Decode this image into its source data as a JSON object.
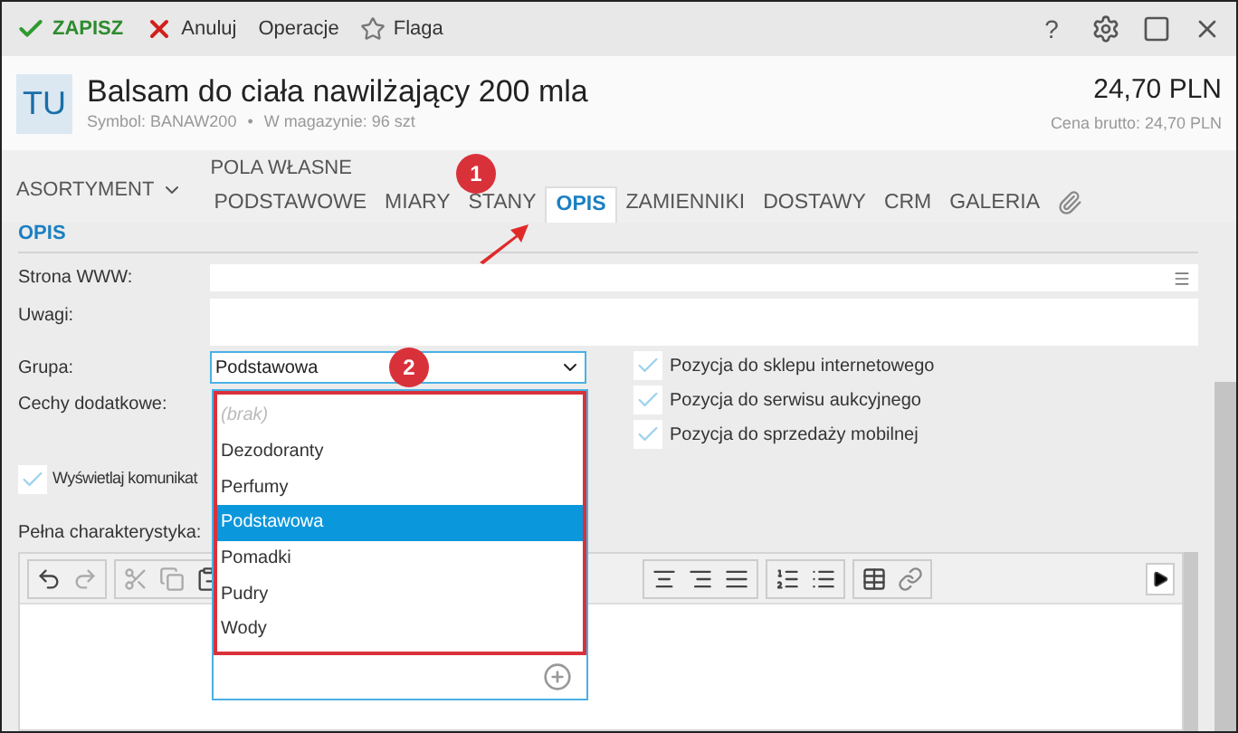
{
  "toolbar": [
    {
      "kind": "save",
      "label": "ZAPISZ"
    },
    {
      "kind": "cancel",
      "label": "Anuluj"
    },
    {
      "kind": "plain",
      "label": "Operacje"
    },
    {
      "kind": "flag",
      "label": "Flaga"
    }
  ],
  "window_controls": {
    "help": "?"
  },
  "header": {
    "avatar": "TU",
    "title": "Balsam do ciała nawilżający 200 mla",
    "symbol": "Symbol: BANAW200",
    "separator": "•",
    "stock": "W magazynie: 96 szt",
    "price": "24,70 PLN",
    "gross": "Cena brutto: 24,70 PLN"
  },
  "menu": {
    "label": "ASORTYMENT"
  },
  "tab_group_label": "POLA WŁASNE",
  "tabs": [
    {
      "label": "PODSTAWOWE",
      "selected": false
    },
    {
      "label": "MIARY",
      "selected": false
    },
    {
      "label": "STANY",
      "selected": false
    },
    {
      "label": "OPIS",
      "selected": true
    },
    {
      "label": "ZAMIENNIKI",
      "selected": false
    },
    {
      "label": "DOSTAWY",
      "selected": false
    },
    {
      "label": "CRM",
      "selected": false
    },
    {
      "label": "GALERIA",
      "selected": false
    }
  ],
  "section_title": "OPIS",
  "form": {
    "www_label": "Strona WWW:",
    "notes_label": "Uwagi:",
    "group_label": "Grupa:",
    "group_value": "Podstawowa",
    "features_label": "Cechy dodatkowe:",
    "description_label": "Pełna charakterystyka:"
  },
  "flags": [
    {
      "label": "Pozycja do sklepu internetowego",
      "checked": true
    },
    {
      "label": "Pozycja do serwisu aukcyjnego",
      "checked": true
    },
    {
      "label": "Pozycja do sprzedaży mobilnej",
      "checked": true
    }
  ],
  "show_message": {
    "label": "Wyświetlaj komunikat",
    "checked": true
  },
  "dropdown": {
    "open": true,
    "options": [
      {
        "kind": "empty",
        "label": "(brak)",
        "selected": false
      },
      {
        "kind": "item",
        "label": "Dezodoranty",
        "selected": false
      },
      {
        "kind": "item",
        "label": "Perfumy",
        "selected": false
      },
      {
        "kind": "item",
        "label": "Podstawowa",
        "selected": true
      },
      {
        "kind": "item",
        "label": "Pomadki",
        "selected": false
      },
      {
        "kind": "item",
        "label": "Pudry",
        "selected": false
      },
      {
        "kind": "item",
        "label": "Wody",
        "selected": false
      }
    ]
  },
  "annotations": [
    "1",
    "2"
  ]
}
